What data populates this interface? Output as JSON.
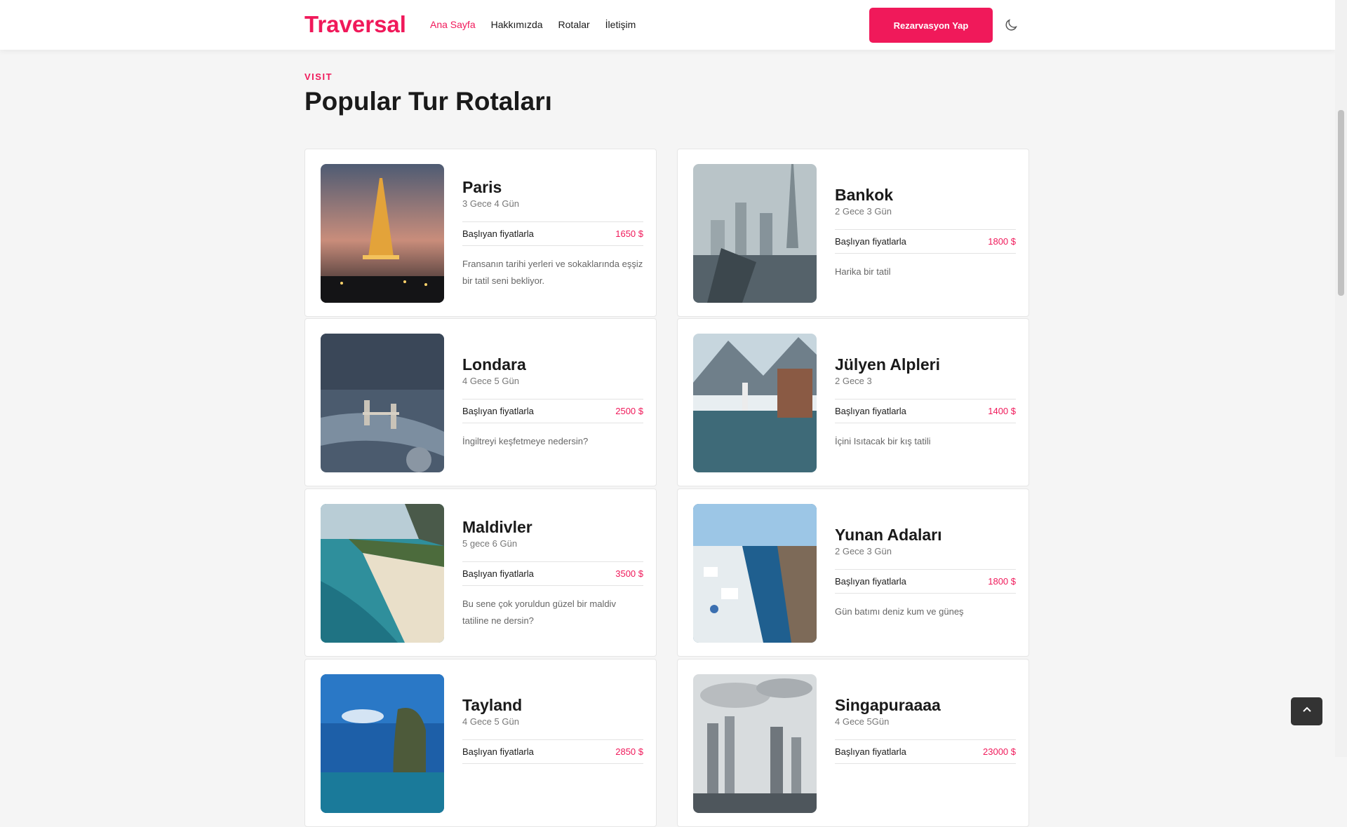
{
  "header": {
    "logo": "Traversal",
    "nav": [
      {
        "label": "Ana Sayfa",
        "active": true
      },
      {
        "label": "Hakkımızda",
        "active": false
      },
      {
        "label": "Rotalar",
        "active": false
      },
      {
        "label": "İletişim",
        "active": false
      }
    ],
    "reserve_button": "Rezarvasyon Yap",
    "theme_icon": "moon-icon"
  },
  "section": {
    "eyebrow": "VISIT",
    "title": "Popular Tur Rotaları"
  },
  "tours": [
    {
      "city": "Paris",
      "duration": "3 Gece 4 Gün",
      "price_label": "Başlıyan fiyatlarla",
      "price": "1650 $",
      "description": "Fransanın tarihi yerleri ve sokaklarında eşşiz bir tatil seni bekliyor."
    },
    {
      "city": "Bankok",
      "duration": "2 Gece 3 Gün",
      "price_label": "Başlıyan fiyatlarla",
      "price": "1800 $",
      "description": "Harika bir tatil"
    },
    {
      "city": "Londara",
      "duration": "4 Gece 5 Gün",
      "price_label": "Başlıyan fiyatlarla",
      "price": "2500 $",
      "description": "İngiltreyi keşfetmeye nedersin?"
    },
    {
      "city": "Jülyen Alpleri",
      "duration": "2 Gece 3",
      "price_label": "Başlıyan fiyatlarla",
      "price": "1400 $",
      "description": "İçini Isıtacak bir kış tatili"
    },
    {
      "city": "Maldivler",
      "duration": "5 gece 6 Gün",
      "price_label": "Başlıyan fiyatlarla",
      "price": "3500 $",
      "description": "Bu sene çok yoruldun güzel bir maldiv tatiline ne dersin?"
    },
    {
      "city": "Yunan Adaları",
      "duration": "2 Gece 3 Gün",
      "price_label": "Başlıyan fiyatlarla",
      "price": "1800 $",
      "description": "Gün batımı deniz kum ve güneş"
    },
    {
      "city": "Tayland",
      "duration": "4 Gece 5 Gün",
      "price_label": "Başlıyan fiyatlarla",
      "price": "2850 $",
      "description": ""
    },
    {
      "city": "Singapuraaaa",
      "duration": "4 Gece 5Gün",
      "price_label": "Başlıyan fiyatlarla",
      "price": "23000 $",
      "description": ""
    }
  ],
  "colors": {
    "accent": "#f0195a",
    "background": "#f5f5f5"
  },
  "back_to_top_icon": "chevron-up-icon"
}
